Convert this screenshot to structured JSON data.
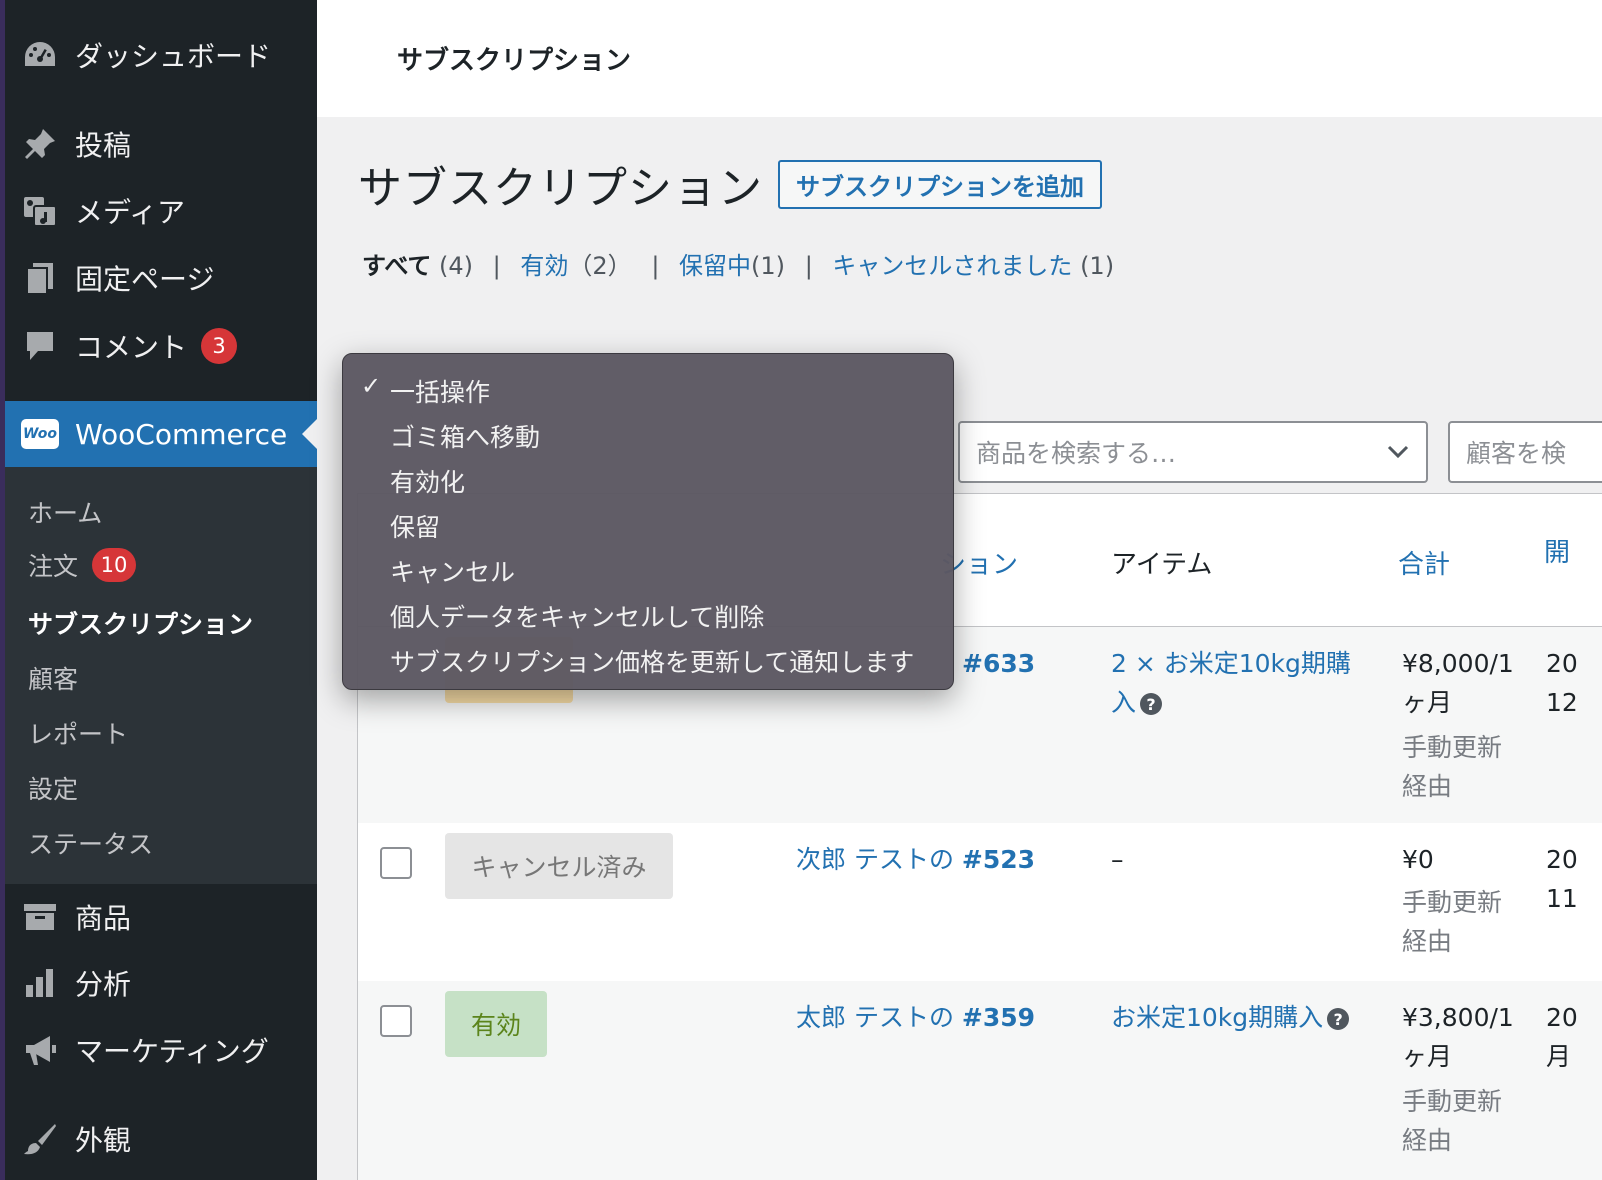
{
  "sidebar": {
    "items": [
      {
        "label": "ダッシュボード",
        "icon": "dashboard-icon"
      },
      {
        "label": "投稿",
        "icon": "pin-icon"
      },
      {
        "label": "メディア",
        "icon": "media-icon"
      },
      {
        "label": "固定ページ",
        "icon": "pages-icon"
      },
      {
        "label": "コメント",
        "icon": "comment-icon",
        "badge": "3"
      },
      {
        "label": "WooCommerce",
        "icon": "woo-icon",
        "icon_text": "Woo"
      },
      {
        "label": "商品",
        "icon": "archive-icon"
      },
      {
        "label": "分析",
        "icon": "bar-chart-icon"
      },
      {
        "label": "マーケティング",
        "icon": "megaphone-icon"
      },
      {
        "label": "外観",
        "icon": "brush-icon"
      }
    ],
    "submenu": [
      {
        "label": "ホーム"
      },
      {
        "label": "注文",
        "badge": "10"
      },
      {
        "label": "サブスクリプション"
      },
      {
        "label": "顧客"
      },
      {
        "label": "レポート"
      },
      {
        "label": "設定"
      },
      {
        "label": "ステータス"
      }
    ]
  },
  "topbar": {
    "title": "サブスクリプション"
  },
  "page": {
    "heading": "サブスクリプション",
    "add_button": "サブスクリプションを追加"
  },
  "views": {
    "all": "すべて",
    "all_count": "(4)",
    "active": "有効",
    "active_count": "（2）",
    "onhold": "保留中",
    "onhold_count": "(1)",
    "cancelled": "キャンセルされました",
    "cancelled_count": "(1)",
    "separator": "|"
  },
  "filters": {
    "product_placeholder": "商品を検索する…",
    "customer_placeholder": "顧客を検"
  },
  "table": {
    "headers": {
      "subscription": "ション",
      "items": "アイテム",
      "total": "合計",
      "start": "開"
    },
    "rows": [
      {
        "status": "",
        "number": "#633",
        "items": "2 × お米定10kg期購",
        "items_2": "入",
        "total": "¥8,000/1",
        "total_2": "ヶ月",
        "via": "手動更新",
        "via_2": "経由",
        "date": "20",
        "date_2": "12"
      },
      {
        "status": "キャンセル済み",
        "name": "次郎 テストの",
        "number": "#523",
        "items": "–",
        "total": "¥0",
        "via": "手動更新",
        "via_2": "経由",
        "date": "20",
        "date_2": "11"
      },
      {
        "status": "有効",
        "name": "太郎 テストの",
        "number": "#359",
        "items": "お米定10kg期購入",
        "total": "¥3,800/1",
        "total_2": "ヶ月",
        "via": "手動更新",
        "via_2": "経由",
        "date": "20",
        "date_2": "月"
      }
    ]
  },
  "bulk_actions": {
    "selected": "一括操作",
    "options": [
      "一括操作",
      "ゴミ箱へ移動",
      "有効化",
      "保留",
      "キャンセル",
      "個人データをキャンセルして削除",
      "サブスクリプション価格を更新して通知します"
    ]
  },
  "colors": {
    "sidebar_bg": "#1d2327",
    "accent": "#2271b1",
    "badge": "#d63638",
    "active_status_bg": "#c6e1c6",
    "cancelled_status_bg": "#e5e5e5"
  }
}
